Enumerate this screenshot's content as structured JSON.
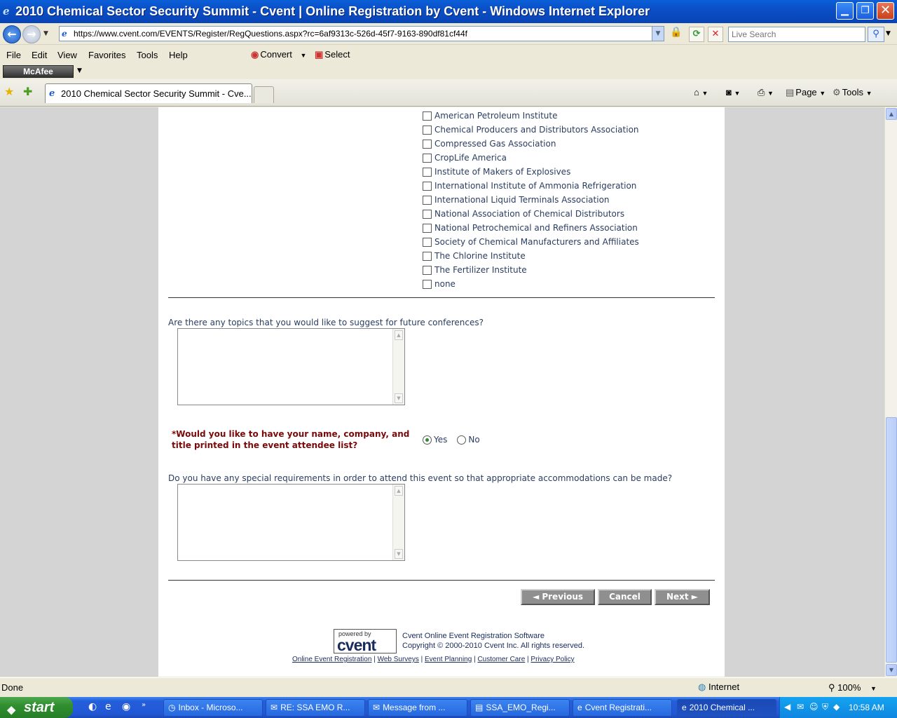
{
  "window": {
    "title": "2010 Chemical Sector Security Summit - Cvent | Online Registration by Cvent - Windows Internet Explorer",
    "min_glyph": "▁",
    "max_glyph": "❐",
    "close_glyph": "✕"
  },
  "address": {
    "url": "https://www.cvent.com/EVENTS/Register/RegQuestions.aspx?rc=6af9313c-526d-45f7-9163-890df81cf44f",
    "search_placeholder": "Live Search"
  },
  "menu": [
    "File",
    "Edit",
    "View",
    "Favorites",
    "Tools",
    "Help"
  ],
  "toolbar": {
    "convert": "Convert",
    "select": "Select",
    "mcafee": "McAfee"
  },
  "tab": {
    "label": "2010 Chemical Sector Security Summit - Cve..."
  },
  "commands": {
    "page": "Page",
    "tools": "Tools"
  },
  "organizations": [
    "American Petroleum Institute",
    "Chemical Producers and Distributors Association",
    "Compressed Gas Association",
    "CropLife America",
    "Institute of Makers of Explosives",
    "International Institute of Ammonia Refrigeration",
    "International Liquid Terminals Association",
    "National Association of Chemical Distributors",
    "National Petrochemical and Refiners Association",
    "Society of Chemical Manufacturers and Affiliates",
    "The Chlorine Institute",
    "The Fertilizer Institute",
    "none"
  ],
  "questions": {
    "topics": "Are there any topics that you would like to suggest for future conferences?",
    "attendee_list": "*Would you like to have your name, company, and title printed in the event attendee list?",
    "yes": "Yes",
    "no": "No",
    "special": "Do you have any special requirements in order to attend this event so that appropriate accommodations can be made?"
  },
  "buttons": {
    "previous": "◄ Previous",
    "cancel": "Cancel",
    "next": "Next ►"
  },
  "footer": {
    "powered_by": "powered by",
    "brand": "cvent",
    "line1": "Cvent Online Event Registration Software",
    "line2": "Copyright © 2000-2010 Cvent Inc. All rights reserved.",
    "links": [
      "Online Event Registration",
      "Web Surveys",
      "Event Planning",
      "Customer Care",
      "Privacy Policy"
    ]
  },
  "status": {
    "text": "Done",
    "zone": "Internet",
    "zoom": "100%"
  },
  "taskbar": {
    "start": "start",
    "tasks": [
      "Inbox - Microso...",
      "RE: SSA EMO R...",
      "Message from ...",
      "SSA_EMO_Regi...",
      "Cvent Registrati...",
      "2010 Chemical ..."
    ],
    "clock": "10:58 AM"
  }
}
